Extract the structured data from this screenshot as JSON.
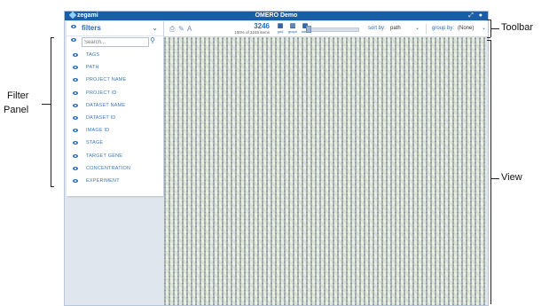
{
  "app": {
    "brand": "zegami",
    "title": "OMERO Demo",
    "window_controls": [
      "expand-icon",
      "help-icon"
    ]
  },
  "filter_panel": {
    "header_label": "filters",
    "search_placeholder": "Search...",
    "items": [
      {
        "label": "TAGS"
      },
      {
        "label": "PATH"
      },
      {
        "label": "PROJECT NAME"
      },
      {
        "label": "PROJECT ID"
      },
      {
        "label": "DATASET NAME"
      },
      {
        "label": "DATASET ID"
      },
      {
        "label": "IMAGE ID"
      },
      {
        "label": "STAGE"
      },
      {
        "label": "TARGET GENE"
      },
      {
        "label": "CONCENTRATION"
      },
      {
        "label": "EXPERIMENT"
      }
    ]
  },
  "toolbar": {
    "count": "3246",
    "count_sub": "100% of 3246 items",
    "view_modes": [
      {
        "label": "grid",
        "icon": "grid-icon"
      },
      {
        "label": "graph",
        "icon": "graph-icon"
      },
      {
        "label": "table",
        "icon": "table-icon"
      }
    ],
    "sort_label": "sort by:",
    "sort_value": "path",
    "group_label": "group by:",
    "group_value": "(None)"
  },
  "callouts": {
    "toolbar": "Toolbar",
    "filter_panel_line1": "Filter",
    "filter_panel_line2": "Panel",
    "view": "View"
  }
}
